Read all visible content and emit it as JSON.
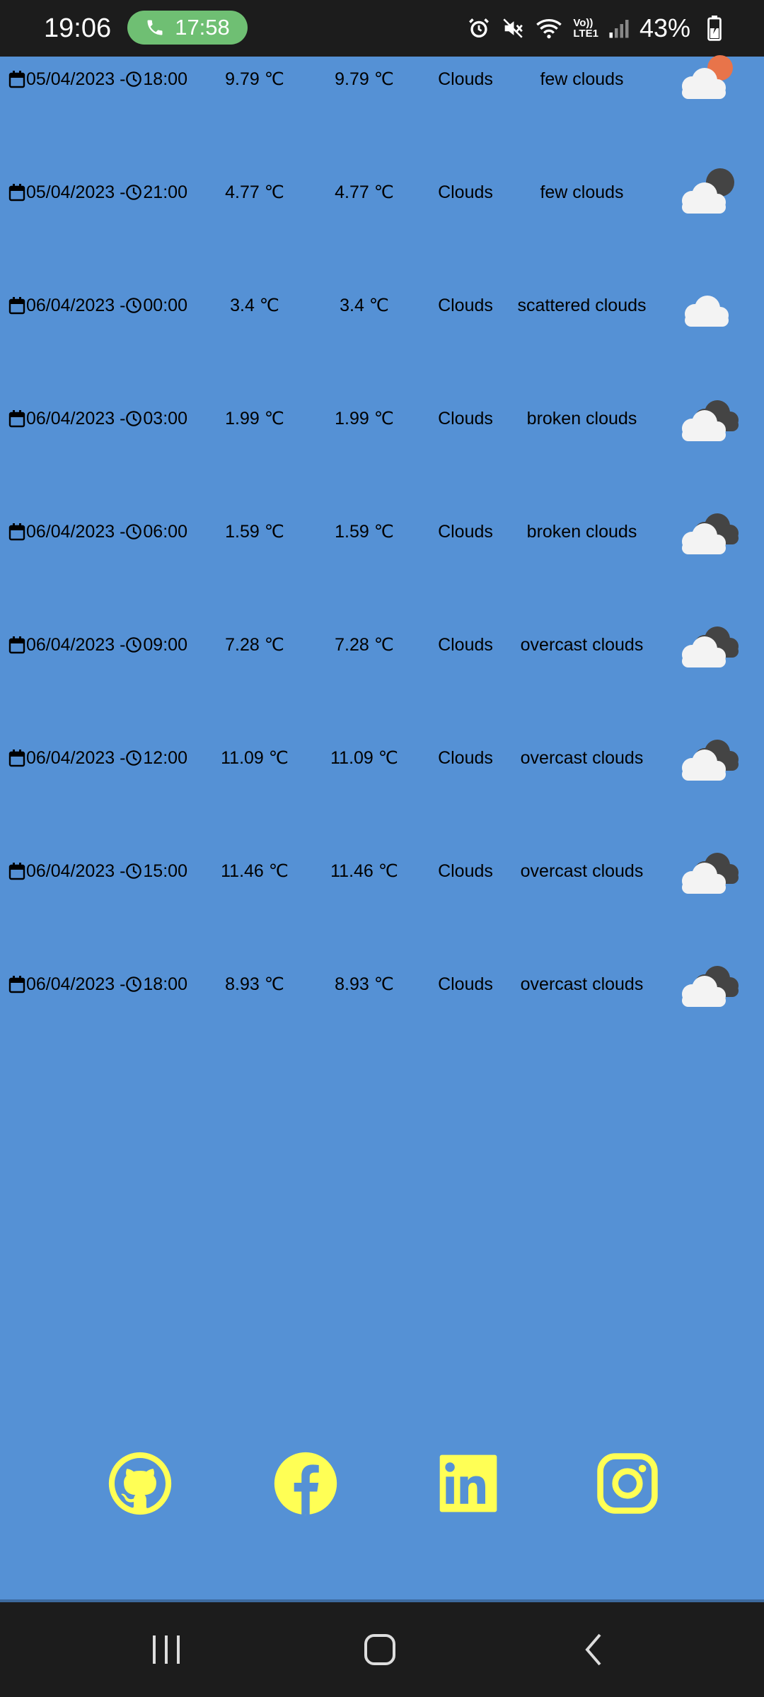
{
  "status_bar": {
    "time": "19:06",
    "call_timer": "17:58",
    "network_top": "Vo))",
    "network_bottom": "LTE1",
    "battery": "43%",
    "icons": [
      "alarm-icon",
      "mute-icon",
      "wifi-icon",
      "lte-icon",
      "signal-icon",
      "battery-icon"
    ]
  },
  "forecast": [
    {
      "date": "05/04/2023 -",
      "time": "18:00",
      "temp": "9.79 ℃",
      "feels": "9.79 ℃",
      "main": "Clouds",
      "desc": "few clouds",
      "icon": "cloud-sun-icon"
    },
    {
      "date": "05/04/2023 -",
      "time": "21:00",
      "temp": "4.77 ℃",
      "feels": "4.77 ℃",
      "main": "Clouds",
      "desc": "few clouds",
      "icon": "cloud-moon-icon"
    },
    {
      "date": "06/04/2023 -",
      "time": "00:00",
      "temp": "3.4 ℃",
      "feels": "3.4 ℃",
      "main": "Clouds",
      "desc": "scattered clouds",
      "icon": "cloud-icon"
    },
    {
      "date": "06/04/2023 -",
      "time": "03:00",
      "temp": "1.99 ℃",
      "feels": "1.99 ℃",
      "main": "Clouds",
      "desc": "broken clouds",
      "icon": "broken-clouds-icon"
    },
    {
      "date": "06/04/2023 -",
      "time": "06:00",
      "temp": "1.59 ℃",
      "feels": "1.59 ℃",
      "main": "Clouds",
      "desc": "broken clouds",
      "icon": "broken-clouds-icon"
    },
    {
      "date": "06/04/2023 -",
      "time": "09:00",
      "temp": "7.28 ℃",
      "feels": "7.28 ℃",
      "main": "Clouds",
      "desc": "overcast clouds",
      "icon": "broken-clouds-icon"
    },
    {
      "date": "06/04/2023 -",
      "time": "12:00",
      "temp": "11.09 ℃",
      "feels": "11.09 ℃",
      "main": "Clouds",
      "desc": "overcast clouds",
      "icon": "broken-clouds-icon"
    },
    {
      "date": "06/04/2023 -",
      "time": "15:00",
      "temp": "11.46 ℃",
      "feels": "11.46 ℃",
      "main": "Clouds",
      "desc": "overcast clouds",
      "icon": "broken-clouds-icon"
    },
    {
      "date": "06/04/2023 -",
      "time": "18:00",
      "temp": "8.93 ℃",
      "feels": "8.93 ℃",
      "main": "Clouds",
      "desc": "overcast clouds",
      "icon": "broken-clouds-icon"
    }
  ],
  "social": [
    "github-icon",
    "facebook-icon",
    "linkedin-icon",
    "instagram-icon"
  ],
  "nav": [
    "recent-apps-icon",
    "home-icon",
    "back-icon"
  ],
  "colors": {
    "background": "#5591d5",
    "social_icon": "#ffff55",
    "system_bar": "#1c1c1c",
    "call_pill": "#6fbf73",
    "sun": "#e8744a",
    "cloud_light": "#f3f3f3",
    "cloud_dark": "#444444"
  }
}
